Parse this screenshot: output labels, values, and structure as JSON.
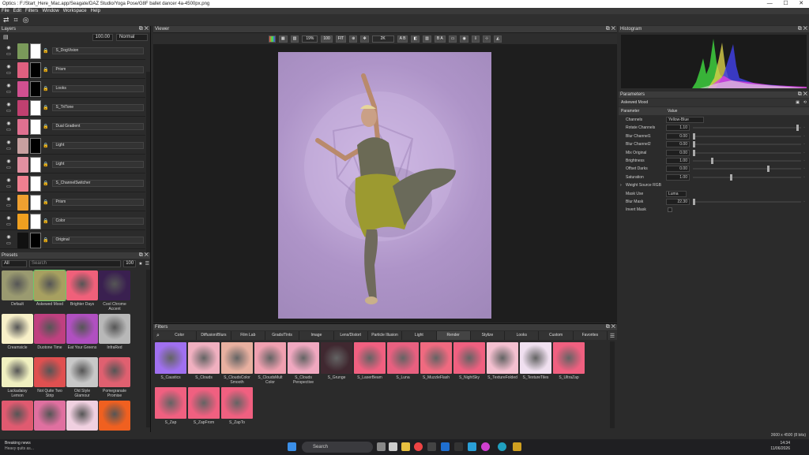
{
  "window": {
    "title": "Optics : F:/Start_Here_Mac.app/Seagate/DAZ Studio/Yoga Pose/G8F ballet dancer 4a-4500px.png",
    "controls": [
      "—",
      "☐",
      "✕"
    ]
  },
  "menu": [
    "File",
    "Edit",
    "Filters",
    "Window",
    "Workspace",
    "Help"
  ],
  "layers": {
    "title": "Layers",
    "opacity": "100.00",
    "blend": "Normal",
    "items": [
      {
        "name": "S_DogVision",
        "thumb": "#7a9a5a",
        "mask": "white"
      },
      {
        "name": "Prism",
        "thumb": "#e06080",
        "mask": "dark"
      },
      {
        "name": "Looks",
        "thumb": "#d05090",
        "mask": "dark"
      },
      {
        "name": "S_TriTone",
        "thumb": "#c04070",
        "mask": "white"
      },
      {
        "name": "Dual Gradient",
        "thumb": "#e07090",
        "mask": "white"
      },
      {
        "name": "Light",
        "thumb": "#c8a0a0",
        "mask": "dark"
      },
      {
        "name": "Light",
        "thumb": "#e090a0",
        "mask": "white"
      },
      {
        "name": "S_ChannelSwitcher",
        "thumb": "#f08090",
        "mask": "white"
      },
      {
        "name": "Prism",
        "thumb": "#f0a030",
        "mask": "white"
      },
      {
        "name": "Color",
        "thumb": "#f0a020",
        "mask": "white"
      },
      {
        "name": "Original",
        "thumb": "#111111",
        "mask": "dark"
      }
    ]
  },
  "presets": {
    "title": "Presets",
    "category": "All",
    "search_placeholder": "Search",
    "size": "100",
    "items": [
      {
        "label": "Default",
        "color": "#9a9a70"
      },
      {
        "label": "Askewed Mood",
        "color": "#a7a060"
      },
      {
        "label": "Brighter Days",
        "color": "#f0607a"
      },
      {
        "label": "Cool Chrome Accent",
        "color": "#3a2050"
      },
      {
        "label": "Creamsicle",
        "color": "#f8f0c8"
      },
      {
        "label": "Duotone Time",
        "color": "#c04080"
      },
      {
        "label": "Eat Your Greens",
        "color": "#b050c0"
      },
      {
        "label": "InfraRed",
        "color": "#b8b8b8"
      },
      {
        "label": "Lackadaisy Lemon",
        "color": "#f0f0c0"
      },
      {
        "label": "Not Quite Two Strip",
        "color": "#e05050"
      },
      {
        "label": "Old Style Glamour",
        "color": "#c8c8c8"
      },
      {
        "label": "Pomegranate Promise",
        "color": "#e06070"
      },
      {
        "label": "",
        "color": "#e05a70"
      },
      {
        "label": "",
        "color": "#e070a0"
      },
      {
        "label": "",
        "color": "#f0d0e0"
      },
      {
        "label": "",
        "color": "#f06020"
      }
    ]
  },
  "viewer": {
    "title": "Viewer",
    "zoom": "19%",
    "tools": [
      "100",
      "FIT"
    ],
    "resolution": "2K",
    "ab": [
      "A B",
      "B A"
    ]
  },
  "filters": {
    "title": "Filters",
    "tabs": [
      "Color",
      "Diffusion/Blurs",
      "Film Lab",
      "Grads/Tints",
      "Image",
      "Lens/Distort",
      "Particle Illusion",
      "Light",
      "Render",
      "Stylize",
      "Looks",
      "Custom",
      "Favorites"
    ],
    "active_tab": "Render",
    "items": [
      {
        "label": "S_Caustics",
        "color": "#a070f0"
      },
      {
        "label": "S_Clouds",
        "color": "#f0b0c0"
      },
      {
        "label": "S_CloudsColor Smooth",
        "color": "#e8b0a0"
      },
      {
        "label": "S_CloudsMult Color",
        "color": "#f0a0b0"
      },
      {
        "label": "S_Clouds Perspective",
        "color": "#f0a8c0"
      },
      {
        "label": "S_Grunge",
        "color": "#402830"
      },
      {
        "label": "S_LaserBeam",
        "color": "#f06080"
      },
      {
        "label": "S_Luna",
        "color": "#e86080"
      },
      {
        "label": "S_MuzzleFlash",
        "color": "#f06a80"
      },
      {
        "label": "S_NightSky",
        "color": "#f06080"
      },
      {
        "label": "S_TextureFolded",
        "color": "#f4c0d0"
      },
      {
        "label": "S_TextureTiles",
        "color": "#f0e0f0"
      },
      {
        "label": "S_UltraZap",
        "color": "#f06080"
      },
      {
        "label": "S_Zap",
        "color": "#f06080"
      },
      {
        "label": "S_ZapFrom",
        "color": "#f06080"
      },
      {
        "label": "S_ZapTo",
        "color": "#f06080"
      }
    ]
  },
  "histogram": {
    "title": "Histogram"
  },
  "parameters": {
    "title": "Parameters",
    "preset_name": "Askewed Mood",
    "col_param": "Parameter",
    "col_value": "Value",
    "rows": [
      {
        "label": "Channels",
        "value": "Yellow-Blue",
        "kind": "select"
      },
      {
        "label": "Rotate Channels",
        "value": "1.10",
        "kind": "slider",
        "pos": 0.98
      },
      {
        "label": "Blur Channel1",
        "value": "0.00",
        "kind": "slider",
        "pos": 0.0
      },
      {
        "label": "Blur Channel2",
        "value": "0.00",
        "kind": "slider",
        "pos": 0.0
      },
      {
        "label": "Mix Original",
        "value": "0.00",
        "kind": "slider",
        "pos": 0.0
      },
      {
        "label": "Brightness",
        "value": "1.00",
        "kind": "slider",
        "pos": 0.17
      },
      {
        "label": "Offset Darks",
        "value": "0.00",
        "kind": "slider",
        "pos": 0.7
      },
      {
        "label": "Saturation",
        "value": "1.00",
        "kind": "slider",
        "pos": 0.35
      },
      {
        "label": "Weight Source RGB",
        "value": "",
        "kind": "group"
      },
      {
        "label": "Mask Use",
        "value": "Luma",
        "kind": "select"
      },
      {
        "label": "Blur Mask",
        "value": "22.30",
        "kind": "slider",
        "pos": 0.0
      },
      {
        "label": "Invert Mask",
        "value": "",
        "kind": "check"
      }
    ]
  },
  "status": {
    "dims": "3600 x 4500 (8 bits)"
  },
  "taskbar": {
    "news_title": "Breaking news",
    "news_sub": "Heavy quits as...",
    "search": "Search",
    "time": "14:34",
    "date": "11/06/2026"
  },
  "colors": {
    "accent": "#7a9a5a",
    "panel": "#2b2b2b",
    "header": "#3b3b3b"
  }
}
